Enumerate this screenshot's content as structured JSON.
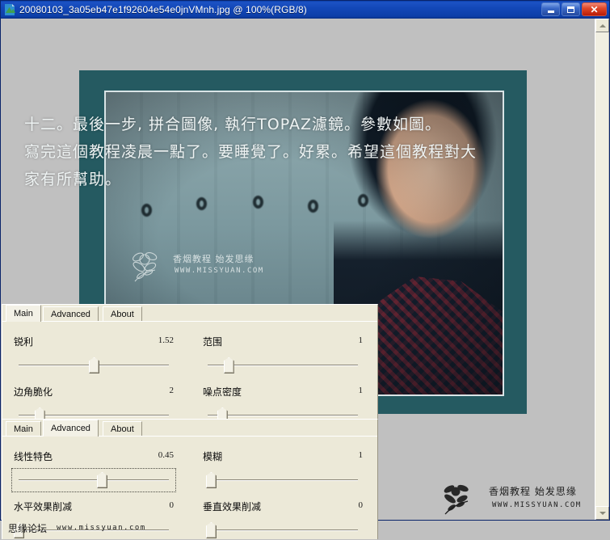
{
  "window": {
    "title": "20080103_3a05eb47e1f92604e54e0jnVMnh.jpg @ 100%(RGB/8)",
    "icon": "photoshop-document-icon",
    "buttons": {
      "minimize": "Minimize",
      "maximize": "Maximize",
      "close": "Close"
    }
  },
  "artwork": {
    "caption_lines": [
      "十二。最後一步, 拼合圖像, 執行TOPAZ濾鏡。參數如圖。",
      "寫完這個教程凌晨一點了。要睡覺了。好累。希望這個教程對大",
      "家有所幫助。"
    ],
    "watermark_light": {
      "title": "香烟教程  始发思缘",
      "url": "WWW.MISSYUAN.COM"
    },
    "watermark_dark": {
      "title": "香烟教程  始发思缘",
      "url": "WWW.MISSYUAN.COM"
    },
    "watermark_forum": {
      "title": "思缘论坛",
      "url": "www.missyuan.com"
    }
  },
  "panel_main": {
    "tabs": [
      {
        "label": "Main",
        "active": true
      },
      {
        "label": "Advanced",
        "active": false
      },
      {
        "label": "About",
        "active": false
      }
    ],
    "controls": [
      {
        "label": "锐利",
        "value": "1.52",
        "thumb_pct": 47
      },
      {
        "label": "范围",
        "value": "1",
        "thumb_pct": 13
      },
      {
        "label": "边角脆化",
        "value": "2",
        "thumb_pct": 13
      },
      {
        "label": "噪点密度",
        "value": "1",
        "thumb_pct": 9
      }
    ]
  },
  "panel_advanced": {
    "tabs": [
      {
        "label": "Main",
        "active": false
      },
      {
        "label": "Advanced",
        "active": true
      },
      {
        "label": "About",
        "active": false
      }
    ],
    "controls": [
      {
        "label": "线性特色",
        "value": "0.45",
        "thumb_pct": 52,
        "focused": true
      },
      {
        "label": "模糊",
        "value": "1",
        "thumb_pct": 2,
        "focused": false
      },
      {
        "label": "水平效果削减",
        "value": "0",
        "thumb_pct": 0,
        "focused": false
      },
      {
        "label": "垂直效果削减",
        "value": "0",
        "thumb_pct": 2,
        "focused": false
      }
    ]
  },
  "scrollbar": {
    "up_arrow": "scroll-up",
    "down_arrow": "scroll-down"
  },
  "colors": {
    "title_bar": "#1348b8",
    "panel_bg": "#ece9d8",
    "artwork_border": "#255a61",
    "canvas": "#c0c0c0",
    "close_button": "#d03a18"
  }
}
